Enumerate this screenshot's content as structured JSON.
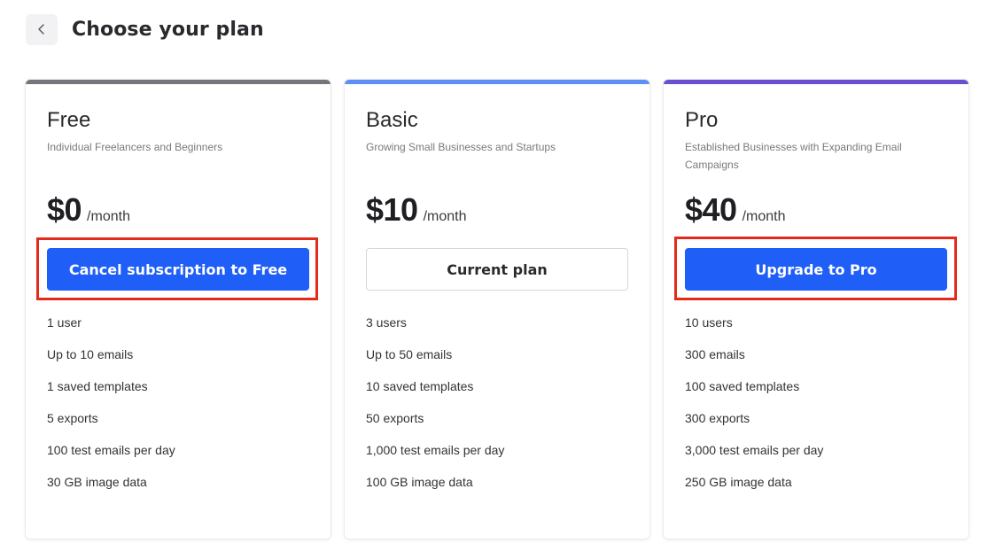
{
  "header": {
    "title": "Choose your plan",
    "back_icon": "chevron-left-icon"
  },
  "colors": {
    "free_bar": "#75767b",
    "basic_bar": "#5d8ff5",
    "pro_bar": "#6b4fd1",
    "primary": "#1f5ef7",
    "highlight": "#e32b1b"
  },
  "plans": [
    {
      "name": "Free",
      "description": "Individual Freelancers and Beginners",
      "price": "$0",
      "period": "/month",
      "button_label": "Cancel subscription to Free",
      "features": [
        "1 user",
        "Up to 10 emails",
        "1 saved templates",
        "5 exports",
        "100 test emails per day",
        "30 GB image data"
      ]
    },
    {
      "name": "Basic",
      "description": "Growing Small Businesses and Startups",
      "price": "$10",
      "period": "/month",
      "button_label": "Current plan",
      "features": [
        "3 users",
        "Up to 50 emails",
        "10 saved templates",
        "50 exports",
        "1,000 test emails per day",
        "100 GB image data"
      ]
    },
    {
      "name": "Pro",
      "description": "Established Businesses with Expanding Email Campaigns",
      "price": "$40",
      "period": "/month",
      "button_label": "Upgrade to Pro",
      "features": [
        "10 users",
        "300 emails",
        "100 saved templates",
        "300 exports",
        "3,000 test emails per day",
        "250 GB image data"
      ]
    }
  ]
}
